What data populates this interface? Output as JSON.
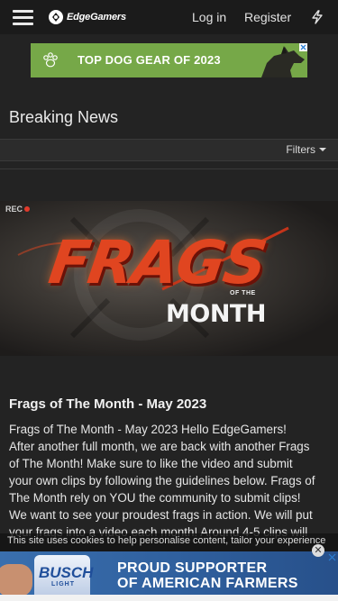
{
  "header": {
    "brand": "EdgeGamers",
    "login": "Log in",
    "register": "Register"
  },
  "top_ad": {
    "text": "TOP DOG GEAR OF 2023",
    "bg_color": "#76a848"
  },
  "page": {
    "title": "Breaking News",
    "filters": "Filters"
  },
  "banner": {
    "rec": "REC",
    "title": "FRAGS",
    "of_the": "OF THE",
    "month": "MONTH"
  },
  "article": {
    "title": "Frags of The Month - May 2023",
    "lines": [
      "Frags of The Month - May 2023 Hello EdgeGamers!",
      "After another full month, we are back with another Frags",
      "of The Month! Make sure to like the video and submit",
      "your own clips by following the guidelines below. Frags of",
      "The Month rely on YOU the community to submit clips!",
      "We want to see your proudest frags in action. We will put",
      "your frags into a video each month! Around 4-5 clips will"
    ]
  },
  "cookie": {
    "text": "This site uses cookies to help personalise content, tailor your experience"
  },
  "bottom_ad": {
    "brand": "BUSCH",
    "sub": "LIGHT",
    "line1": "PROUD SUPPORTER",
    "line2": "OF AMERICAN FARMERS",
    "close": "✕"
  },
  "colors": {
    "background": "#232323",
    "topbar": "#1b1b1b",
    "banner_accent": "#e04520"
  }
}
